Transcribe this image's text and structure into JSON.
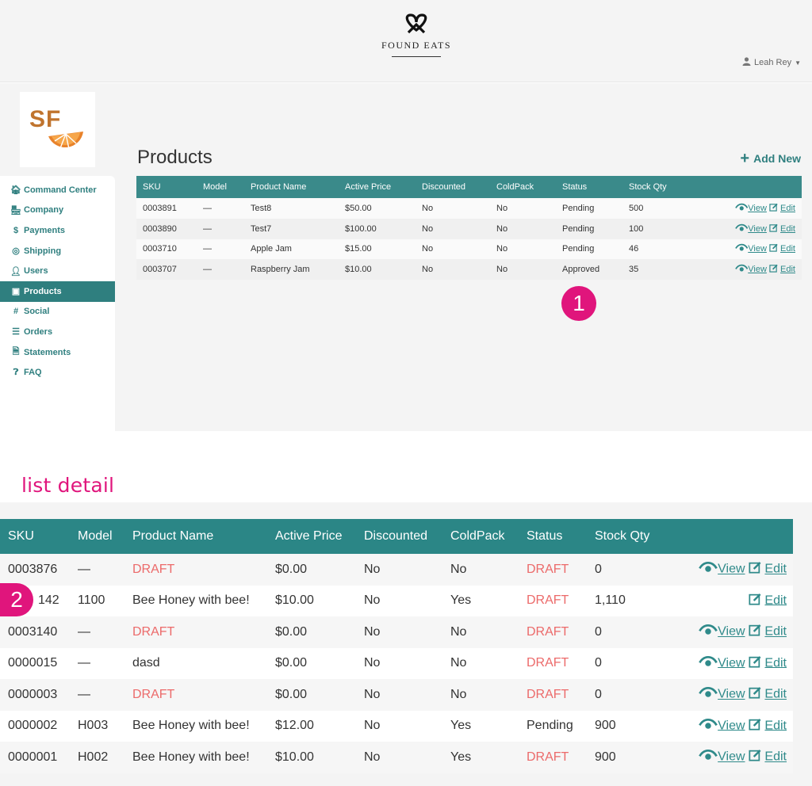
{
  "header": {
    "brand": "FOUND EATS",
    "user": "Leah Rey",
    "user_icon": "person-icon",
    "logo_icon": "pretzel-icon"
  },
  "supplier_logo": {
    "text": "SF"
  },
  "sidebar": {
    "items": [
      {
        "label": "Command Center",
        "icon": "home-icon",
        "glyph": "🏠︎"
      },
      {
        "label": "Company",
        "icon": "storefront-icon",
        "glyph": "🏪︎"
      },
      {
        "label": "Payments",
        "icon": "dollar-icon",
        "glyph": "$"
      },
      {
        "label": "Shipping",
        "icon": "globe-icon",
        "glyph": "◎"
      },
      {
        "label": "Users",
        "icon": "user-icon",
        "glyph": "👤︎"
      },
      {
        "label": "Products",
        "icon": "box-icon",
        "glyph": "▣"
      },
      {
        "label": "Social",
        "icon": "hashtag-icon",
        "glyph": "#"
      },
      {
        "label": "Orders",
        "icon": "truck-icon",
        "glyph": "☰"
      },
      {
        "label": "Statements",
        "icon": "document-icon",
        "glyph": "🗎︎"
      },
      {
        "label": "FAQ",
        "icon": "question-icon",
        "glyph": "❓︎"
      }
    ],
    "active_index": 5
  },
  "main": {
    "title": "Products",
    "add_new": "Add New"
  },
  "products_table": {
    "columns": [
      "SKU",
      "Model",
      "Product Name",
      "Active Price",
      "Discounted",
      "ColdPack",
      "Status",
      "Stock Qty"
    ],
    "rows": [
      [
        "0003891",
        "—",
        "Test8",
        "$50.00",
        "No",
        "No",
        "Pending",
        "500"
      ],
      [
        "0003890",
        "—",
        "Test7",
        "$100.00",
        "No",
        "No",
        "Pending",
        "100"
      ],
      [
        "0003710",
        "—",
        "Apple Jam",
        "$15.00",
        "No",
        "No",
        "Pending",
        "46"
      ],
      [
        "0003707",
        "—",
        "Raspberry Jam",
        "$10.00",
        "No",
        "No",
        "Approved",
        "35"
      ]
    ],
    "view_label": "View",
    "edit_label": "Edit"
  },
  "annotations": {
    "badge1": "1",
    "badge2": "2",
    "section_label": "list detail"
  },
  "detail_table": {
    "columns": [
      "SKU",
      "Model",
      "Product Name",
      "Active Price",
      "Discounted",
      "ColdPack",
      "Status",
      "Stock Qty"
    ],
    "rows": [
      {
        "cells": [
          "0003876",
          "—",
          "DRAFT",
          "$0.00",
          "No",
          "No",
          "DRAFT",
          "0"
        ],
        "view": true
      },
      {
        "cells": [
          "142",
          "1100",
          "Bee Honey with bee!",
          "$10.00",
          "No",
          "Yes",
          "DRAFT",
          "1,110"
        ],
        "view": false
      },
      {
        "cells": [
          "0003140",
          "—",
          "DRAFT",
          "$0.00",
          "No",
          "No",
          "DRAFT",
          "0"
        ],
        "view": true
      },
      {
        "cells": [
          "0000015",
          "—",
          "dasd",
          "$0.00",
          "No",
          "No",
          "DRAFT",
          "0"
        ],
        "view": true
      },
      {
        "cells": [
          "0000003",
          "—",
          "DRAFT",
          "$0.00",
          "No",
          "No",
          "DRAFT",
          "0"
        ],
        "view": true
      },
      {
        "cells": [
          "0000002",
          "H003",
          "Bee Honey with bee!",
          "$12.00",
          "No",
          "Yes",
          "Pending",
          "900"
        ],
        "view": true
      },
      {
        "cells": [
          "0000001",
          "H002",
          "Bee Honey with bee!",
          "$10.00",
          "No",
          "Yes",
          "DRAFT",
          "900"
        ],
        "view": true
      }
    ],
    "view_label": "View",
    "edit_label": "Edit"
  },
  "colors": {
    "teal": "#2f7f7f",
    "header_teal": "#3a8a8a",
    "draft_red": "#ec6a6a",
    "accent_pink": "#e0157c",
    "sf_orange": "#c0742e"
  }
}
